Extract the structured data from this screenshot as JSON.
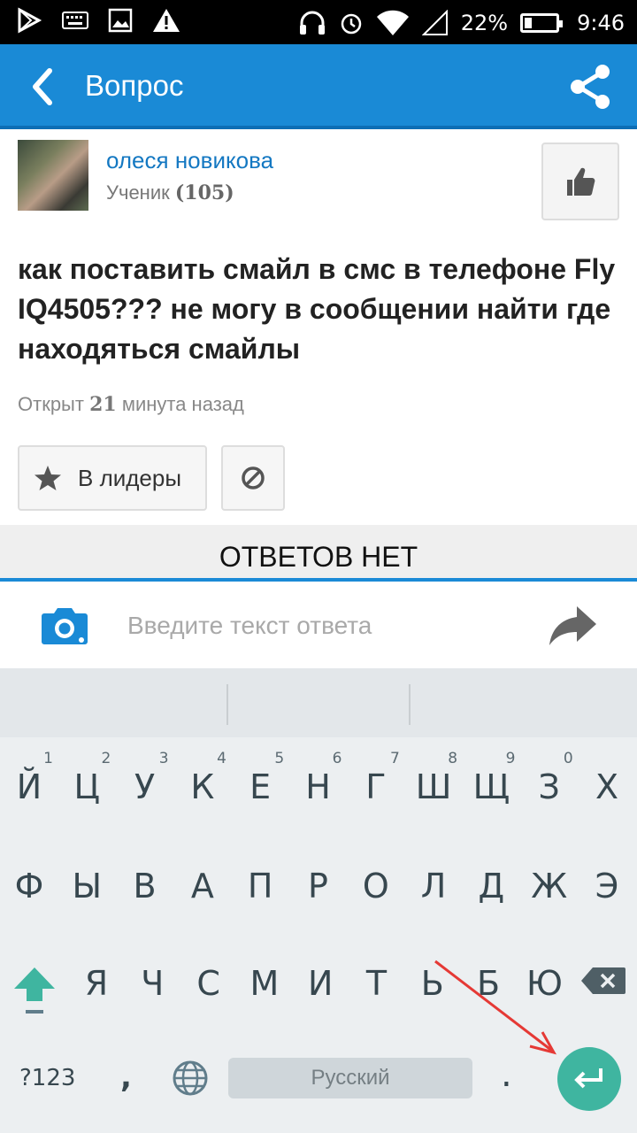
{
  "status_bar": {
    "battery": "22%",
    "battery_level": 0.22,
    "time": "9:46",
    "icons": [
      "play-store-icon",
      "keyboard-icon",
      "image-icon",
      "warning-icon",
      "headset-icon",
      "alarm-icon",
      "wifi-icon",
      "signal-icon",
      "battery-icon"
    ]
  },
  "app_bar": {
    "title": "Вопрос"
  },
  "author": {
    "name": "олеся новикова",
    "rank_label": "Ученик",
    "rank_points": "(105)"
  },
  "question": {
    "text": "как поставить смайл в смс в телефоне Fly IQ4505??? не могу в сообщении найти где находяться смайлы"
  },
  "opened": {
    "prefix": "Открыт",
    "number": "21",
    "suffix": "минута назад"
  },
  "actions": {
    "leaders_label": "В лидеры"
  },
  "answers": {
    "header": "ОТВЕТОВ НЕТ"
  },
  "reply": {
    "placeholder": "Введите текст ответа"
  },
  "keyboard": {
    "row1": [
      "Й",
      "Ц",
      "У",
      "К",
      "Е",
      "Н",
      "Г",
      "Ш",
      "Щ",
      "З",
      "Х"
    ],
    "row1_hints": [
      "1",
      "2",
      "3",
      "4",
      "5",
      "6",
      "7",
      "8",
      "9",
      "0",
      ""
    ],
    "row2": [
      "Ф",
      "Ы",
      "В",
      "А",
      "П",
      "Р",
      "О",
      "Л",
      "Д",
      "Ж",
      "Э"
    ],
    "row3": [
      "Я",
      "Ч",
      "С",
      "М",
      "И",
      "Т",
      "Ь",
      "Б",
      "Ю"
    ],
    "symbols": "?123",
    "comma": ",",
    "space": "Русский",
    "period": "."
  },
  "colors": {
    "accent": "#1a8ad6",
    "enter_key": "#3fb5a0",
    "annotation_arrow": "#e53935"
  }
}
